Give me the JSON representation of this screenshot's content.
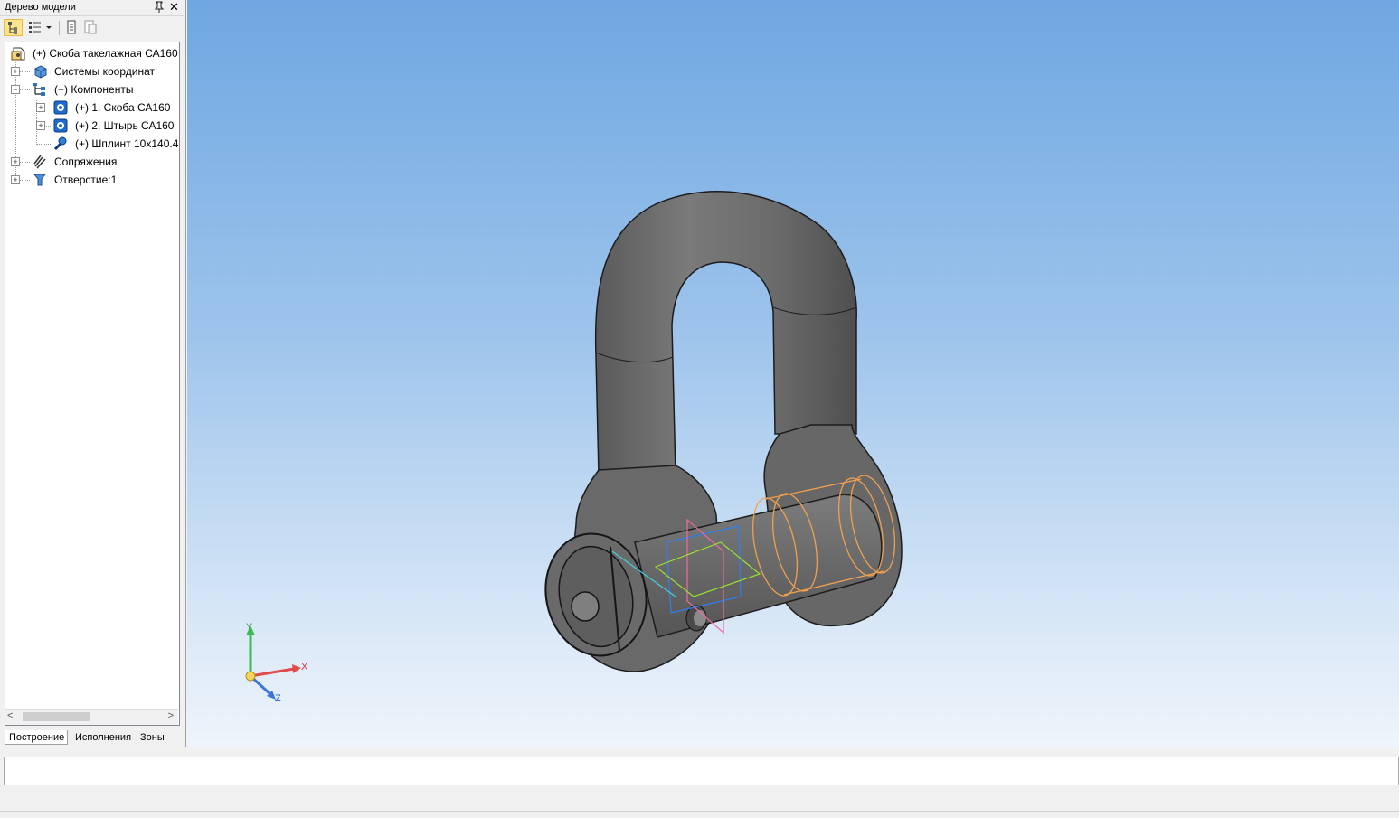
{
  "panel": {
    "title": "Дерево модели",
    "pin_icon": "pin-icon",
    "close_label": "✕"
  },
  "tree": {
    "root": "(+) Скоба такелажная СА160",
    "coords": "Системы координат",
    "components": "(+) Компоненты",
    "comp1": "(+) 1. Скоба СА160",
    "comp2": "(+) 2. Штырь СА160",
    "comp3": "(+) Шплинт 10х140.4",
    "mates": "Сопряжения",
    "hole": "Отверстие:1"
  },
  "tabs": {
    "build": "Построение",
    "exec": "Исполнения",
    "zones": "Зоны"
  },
  "axes": {
    "x": "X",
    "y": "Y",
    "z": "Z"
  },
  "colors": {
    "selection": "#fde48b",
    "model": "#6f6f6f",
    "highlight": "#f0a050"
  }
}
